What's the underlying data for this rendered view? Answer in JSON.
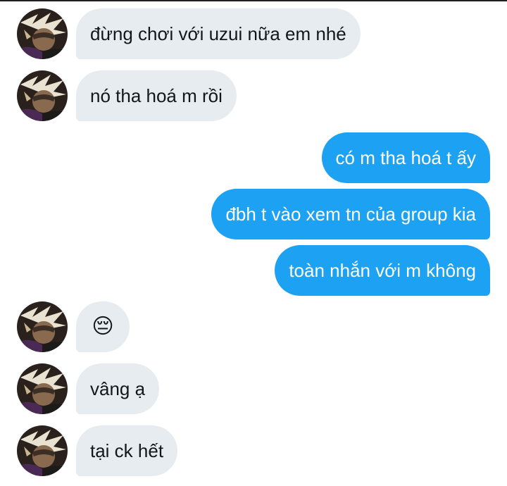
{
  "conversation": {
    "messages": [
      {
        "sender": "them",
        "text": "đừng chơi với uzui nữa em nhé"
      },
      {
        "sender": "them",
        "text": "nó tha hoá m rồi"
      },
      {
        "sender": "me",
        "text": "có m tha hoá t ấy"
      },
      {
        "sender": "me",
        "text": "đbh t vào xem tn của group kia"
      },
      {
        "sender": "me",
        "text": "toàn nhắn với m không"
      },
      {
        "sender": "them",
        "text": "😔"
      },
      {
        "sender": "them",
        "text": "vâng ạ"
      },
      {
        "sender": "them",
        "text": "tại ck hết"
      }
    ]
  },
  "colors": {
    "incoming_bubble": "#e6ecf0",
    "outgoing_bubble": "#1da1f2",
    "incoming_text": "#14171a",
    "outgoing_text": "#ffffff"
  },
  "icons": {
    "avatar": "user-avatar-image"
  }
}
